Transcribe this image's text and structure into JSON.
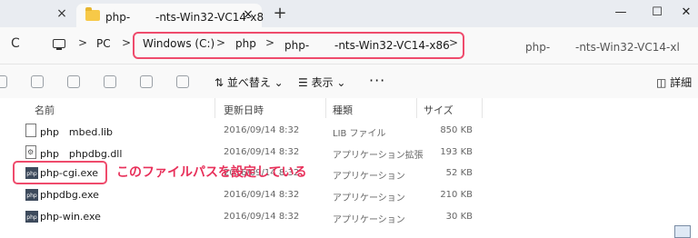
{
  "tab": {
    "title": "php-　　 -nts-Win32-VC14-x8",
    "prev_close": "×",
    "close": "×",
    "new": "+"
  },
  "window": {
    "minimize": "—",
    "maximize": "☐",
    "close": "✕"
  },
  "address": {
    "refresh": "C",
    "crumbs": [
      "PC",
      "Windows (C:)",
      "php",
      "php-　　 -nts-Win32-VC14-x86"
    ],
    "sep": ">",
    "search_placeholder": "php-　　 -nts-Win32-VC14-xl"
  },
  "commands": {
    "sort": "⇅  並べ替え ⌄",
    "view": "☰  表示 ⌄",
    "more": "···",
    "details": "◫  詳細"
  },
  "columns": {
    "name": "名前",
    "date": "更新日時",
    "type": "種類",
    "size": "サイズ"
  },
  "files": [
    {
      "icon": "file-icon",
      "name": "php　mbed.lib",
      "date": "2016/09/14 8:32",
      "type": "LIB ファイル",
      "size": "850 KB"
    },
    {
      "icon": "dll-file-icon",
      "name": "php　phpdbg.dll",
      "date": "2016/09/14 8:32",
      "type": "アプリケーション拡張",
      "size": "193 KB"
    },
    {
      "icon": "php-exe-icon",
      "name": "php-cgi.exe",
      "date": "2016/09/14 8:32",
      "type": "アプリケーション",
      "size": "52 KB"
    },
    {
      "icon": "php-exe-icon",
      "name": "phpdbg.exe",
      "date": "2016/09/14 8:32",
      "type": "アプリケーション",
      "size": "210 KB"
    },
    {
      "icon": "php-exe-icon",
      "name": "php-win.exe",
      "date": "2016/09/14 8:32",
      "type": "アプリケーション",
      "size": "30 KB"
    }
  ],
  "exe_icon_text": "php",
  "annotation": "このファイルパスを設定している",
  "colors": {
    "highlight": "#ef4b6c",
    "annotation": "#e8305a"
  }
}
